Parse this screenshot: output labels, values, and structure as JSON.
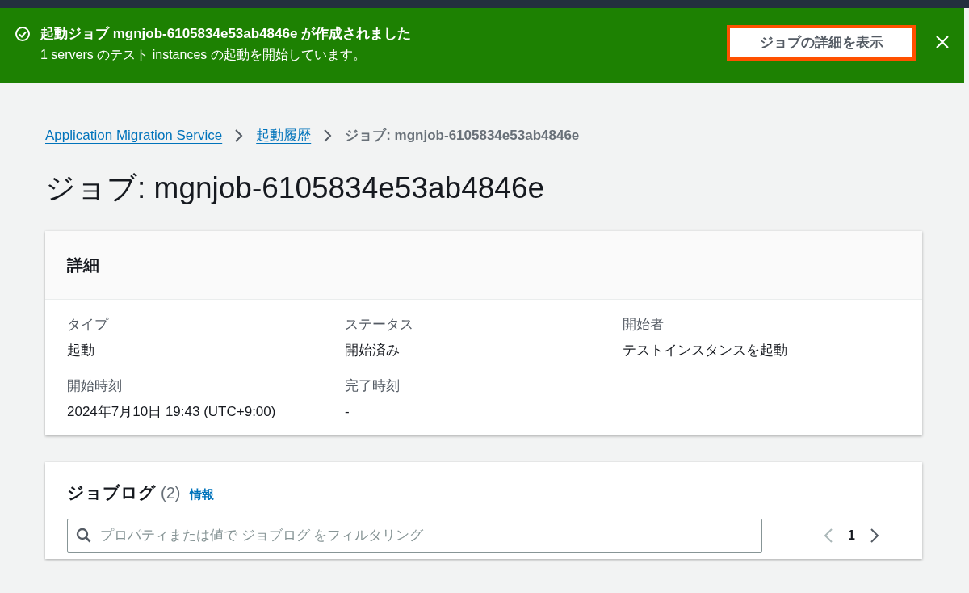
{
  "notification": {
    "title": "起動ジョブ mgnjob-6105834e53ab4846e が作成されました",
    "message": "1 servers のテスト instances の起動を開始しています。",
    "action_button": "ジョブの詳細を表示"
  },
  "breadcrumbs": [
    {
      "label": "Application Migration Service",
      "link": true
    },
    {
      "label": "起動履歴",
      "link": true
    },
    {
      "label": "ジョブ: mgnjob-6105834e53ab4846e",
      "link": false
    }
  ],
  "page_title": "ジョブ: mgnjob-6105834e53ab4846e",
  "details": {
    "title": "詳細",
    "fields": [
      {
        "label": "タイプ",
        "value": "起動"
      },
      {
        "label": "ステータス",
        "value": "開始済み"
      },
      {
        "label": "開始者",
        "value": "テストインスタンスを起動"
      },
      {
        "label": "開始時刻",
        "value": "2024年7月10日 19:43 (UTC+9:00)"
      },
      {
        "label": "完了時刻",
        "value": "-"
      }
    ]
  },
  "job_log": {
    "title": "ジョブログ",
    "count": "(2)",
    "info_link": "情報",
    "search": {
      "placeholder": "プロパティまたは値で ジョブログ をフィルタリング"
    },
    "pagination": {
      "previous_disabled": true,
      "next_disabled": false,
      "pages": [
        {
          "label": "1",
          "selected": true
        }
      ]
    }
  }
}
